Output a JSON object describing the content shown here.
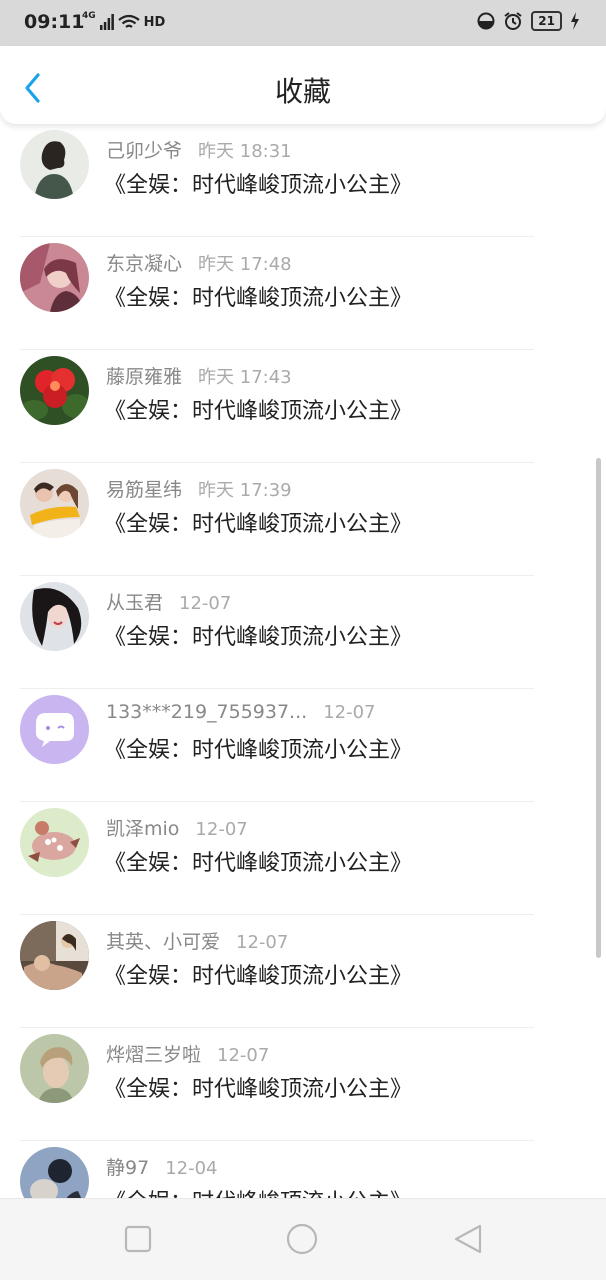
{
  "status_bar": {
    "time": "09:11",
    "network": "4G",
    "hd": "HD",
    "battery": "21"
  },
  "header": {
    "title": "收藏"
  },
  "items": [
    {
      "name": "己卯少爷",
      "time": "昨天 18:31",
      "book": "《全娱：时代峰峻顶流小公主》"
    },
    {
      "name": "东京凝心",
      "time": "昨天 17:48",
      "book": "《全娱：时代峰峻顶流小公主》"
    },
    {
      "name": "藤原雍雅",
      "time": "昨天 17:43",
      "book": "《全娱：时代峰峻顶流小公主》"
    },
    {
      "name": "易筋星纬",
      "time": "昨天 17:39",
      "book": "《全娱：时代峰峻顶流小公主》"
    },
    {
      "name": "从玉君",
      "time": "12-07",
      "book": "《全娱：时代峰峻顶流小公主》"
    },
    {
      "name": "133***219_755937...",
      "time": "12-07",
      "book": "《全娱：时代峰峻顶流小公主》"
    },
    {
      "name": "凯泽mio",
      "time": "12-07",
      "book": "《全娱：时代峰峻顶流小公主》"
    },
    {
      "name": "其英、小可爱",
      "time": "12-07",
      "book": "《全娱：时代峰峻顶流小公主》"
    },
    {
      "name": "烨熠三岁啦",
      "time": "12-07",
      "book": "《全娱：时代峰峻顶流小公主》"
    },
    {
      "name": "静97",
      "time": "12-04",
      "book": "《全娱：时代峰峻顶流小公主》"
    }
  ],
  "colors": {
    "accent": "#1aa3e8",
    "status_bar_bg": "#d9d9d9",
    "placeholder_avatar_bg": "#c9b6f0"
  },
  "icons": {
    "back": "chevron-left-icon",
    "nav_recent": "square-icon",
    "nav_home": "circle-icon",
    "nav_back": "triangle-left-icon"
  }
}
